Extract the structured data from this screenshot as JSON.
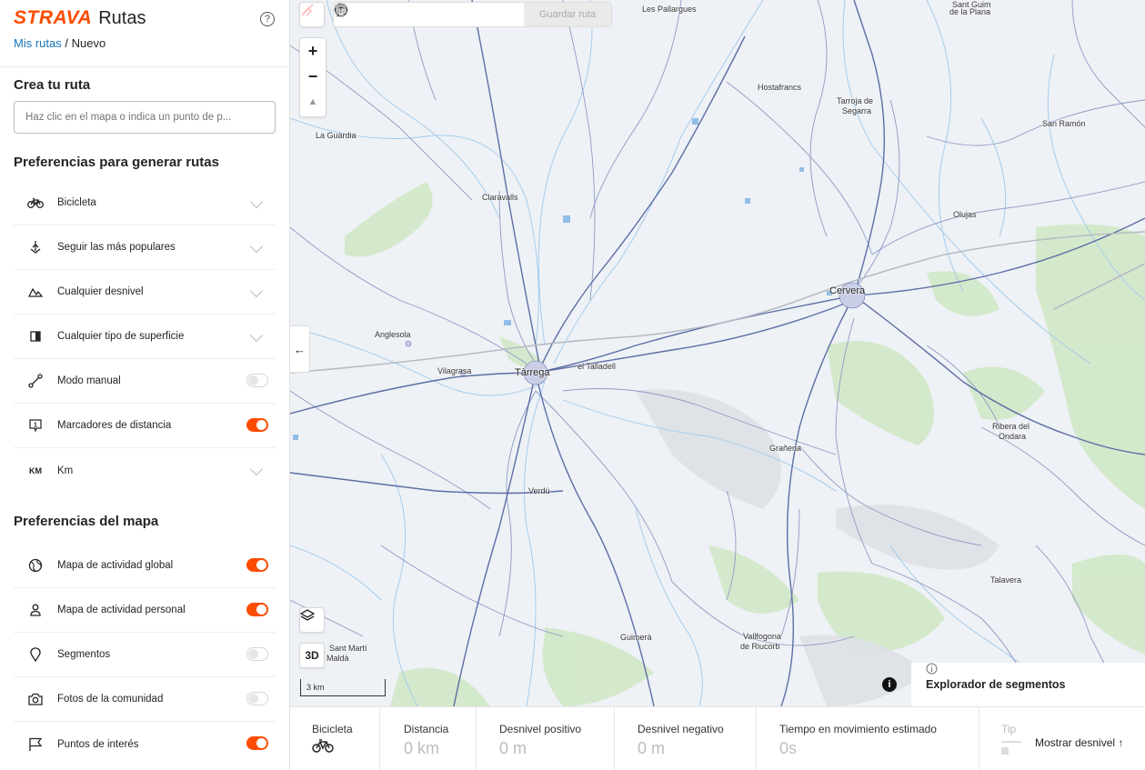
{
  "header": {
    "brand": "STRAVA",
    "title": "Rutas",
    "help_icon": "?"
  },
  "breadcrumb": {
    "link": "Mis rutas",
    "separator": "/",
    "current": "Nuevo"
  },
  "create": {
    "title": "Crea tu ruta",
    "search_placeholder": "Haz clic en el mapa o indica un punto de p..."
  },
  "route_prefs": {
    "title": "Preferencias para generar rutas",
    "items": [
      {
        "label": "Bicicleta",
        "icon": "bike-icon",
        "control": "dropdown"
      },
      {
        "label": "Seguir las más populares",
        "icon": "popularity-icon",
        "control": "dropdown"
      },
      {
        "label": "Cualquier desnivel",
        "icon": "elevation-icon",
        "control": "dropdown"
      },
      {
        "label": "Cualquier tipo de superficie",
        "icon": "surface-icon",
        "control": "dropdown"
      },
      {
        "label": "Modo manual",
        "icon": "manual-mode-icon",
        "control": "toggle",
        "on": false
      },
      {
        "label": "Marcadores de distancia",
        "icon": "distance-marker-icon",
        "icon_text": "1",
        "control": "toggle",
        "on": true
      },
      {
        "label": "Km",
        "icon": "units-icon",
        "icon_text": "KM",
        "control": "dropdown"
      }
    ]
  },
  "map_prefs": {
    "title": "Preferencias del mapa",
    "items": [
      {
        "label": "Mapa de actividad global",
        "icon": "globe-icon",
        "on": true
      },
      {
        "label": "Mapa de actividad personal",
        "icon": "person-icon",
        "on": true
      },
      {
        "label": "Segmentos",
        "icon": "location-pin-icon",
        "on": false
      },
      {
        "label": "Fotos de la comunidad",
        "icon": "camera-icon",
        "on": false
      },
      {
        "label": "Puntos de interés",
        "icon": "flag-icon",
        "on": true
      }
    ]
  },
  "toolbar": {
    "save_label": "Guardar ruta"
  },
  "map": {
    "zoom_in": "+",
    "zoom_out": "−",
    "compass": "▲",
    "view_3d": "3D",
    "collapse": "←",
    "scale": "3 km",
    "segment_explorer": "Explorador de segmentos",
    "info": "i",
    "towns": [
      {
        "name": "Les Pallargues",
        "big": false
      },
      {
        "name": "Sant Guim",
        "big": false
      },
      {
        "name": "de la Plana",
        "big": false
      },
      {
        "name": "Hostafrancs",
        "big": false
      },
      {
        "name": "Tarroja de",
        "big": false
      },
      {
        "name": "Segarra",
        "big": false
      },
      {
        "name": "San Ramón",
        "big": false
      },
      {
        "name": "La Guàrdia",
        "big": false
      },
      {
        "name": "Claravalls",
        "big": false
      },
      {
        "name": "Olujas",
        "big": false
      },
      {
        "name": "Cervera",
        "big": true
      },
      {
        "name": "Anglesola",
        "big": false
      },
      {
        "name": "Vilagrasa",
        "big": false
      },
      {
        "name": "Tàrrega",
        "big": true
      },
      {
        "name": "el Talladell",
        "big": false
      },
      {
        "name": "Ribera del",
        "big": false
      },
      {
        "name": "Ondara",
        "big": false
      },
      {
        "name": "Grañena",
        "big": false
      },
      {
        "name": "Verdú",
        "big": false
      },
      {
        "name": "Talavera",
        "big": false
      },
      {
        "name": "Guimerà",
        "big": false
      },
      {
        "name": "Vallfogona",
        "big": false
      },
      {
        "name": "de Riucorb",
        "big": false
      },
      {
        "name": "Sant Martí",
        "big": false
      },
      {
        "name": "Maldà",
        "big": false
      }
    ]
  },
  "stats": {
    "sport_label": "Bicicleta",
    "distance_label": "Distancia",
    "distance_value": "0 km",
    "elev_gain_label": "Desnivel positivo",
    "elev_gain_value": "0 m",
    "elev_loss_label": "Desnivel negativo",
    "elev_loss_value": "0 m",
    "time_label": "Tiempo en movimiento estimado",
    "time_value": "0s",
    "type_label": "Tip",
    "show_elevation": "Mostrar desnivel ↑"
  },
  "colors": {
    "accent": "#fc4c02",
    "link": "#1a73b5",
    "map_bg": "#eef1f5",
    "road": "#5d6ea6",
    "water": "#8fbfe8",
    "park": "#cfe8c4"
  }
}
